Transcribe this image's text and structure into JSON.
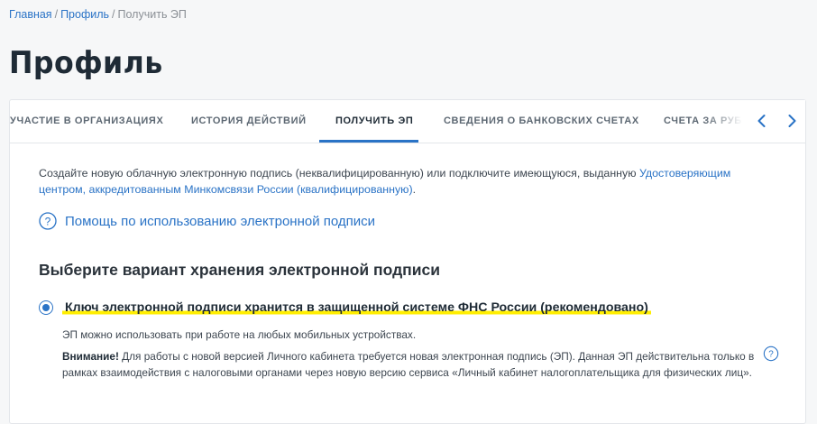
{
  "breadcrumb": {
    "items": [
      "Главная",
      "Профиль",
      "Получить ЭП"
    ],
    "separator": "/"
  },
  "page_title": "Профиль",
  "tabs": {
    "items": [
      {
        "label": "УЧАСТИЕ В ОРГАНИЗАЦИЯХ"
      },
      {
        "label": "ИСТОРИЯ ДЕЙСТВИЙ"
      },
      {
        "label": "ПОЛУЧИТЬ ЭП"
      },
      {
        "label": "СВЕДЕНИЯ О БАНКОВСКИХ СЧЕТАХ"
      },
      {
        "label": "СЧЕТА ЗА РУБЕЖОМ"
      }
    ],
    "active_index": 2,
    "prev_icon": "chevron-left-icon",
    "next_icon": "chevron-right-icon"
  },
  "intro": {
    "text": "Создайте новую облачную электронную подпись (неквалифицированную) или подключите имеющуюся, выданную ",
    "link_text": "Удостоверяющим центром, аккредитованным Минкомсвязи России (квалифицированную)",
    "suffix": "."
  },
  "help": {
    "icon": "question-circle-icon",
    "link_text": "Помощь по использованию электронной подписи"
  },
  "section_title": "Выберите вариант хранения электронной подписи",
  "option": {
    "selected": true,
    "label": "Ключ электронной подписи хранится в защищенной системе ФНС России (рекомендовано)",
    "note": "ЭП можно использовать при работе на любых мобильных устройствах.",
    "warning_label": "Внимание!",
    "warning_text": " Для работы с новой версией Личного кабинета требуется новая электронная подпись (ЭП). Данная ЭП  действительна только в рамках взаимодействия с налоговыми органами через новую версию сервиса  «Личный кабинет налогоплательщика для физических лиц».",
    "warning_icon": "question-circle-icon"
  },
  "colors": {
    "accent": "#2a73c6",
    "highlight": "#ffee00",
    "title": "#1f2b36",
    "body_text": "#3d4650",
    "muted": "#8a8f95",
    "background": "#f6f7f8"
  }
}
